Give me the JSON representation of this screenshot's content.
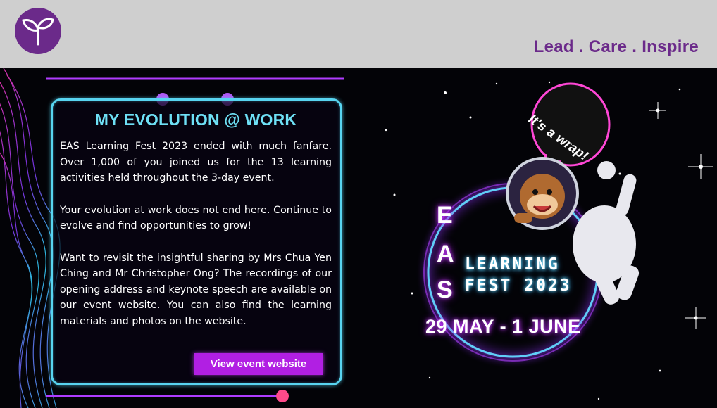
{
  "header": {
    "tagline": "Lead . Care . Inspire",
    "background_color": "#cfcfcf",
    "brand_color": "#6b2a8a",
    "logo_icon": "sprout-icon"
  },
  "card": {
    "title": "MY EVOLUTION @ WORK",
    "paragraphs": [
      "EAS Learning Fest 2023 ended with much fanfare. Over 1,000 of you joined us for the 13 learning activities held throughout the 3-day event.",
      "Your evolution at work does not end here. Continue to evolve and find opportunities to grow!",
      "Want to revisit the insightful sharing by Mrs Chua Yen Ching and Mr Christopher Ong? The recordings of our opening address and keynote speech are available on our event website. You can also find the learning materials and photos on the website."
    ],
    "cta_label": "View event website",
    "border_color": "#58d4f0",
    "cta_color": "#b11fe3"
  },
  "fest": {
    "speech_bubble": "It's a wrap!",
    "eas_letters": [
      "E",
      "A",
      "S"
    ],
    "learning_word": "LEARNING",
    "fest_year": "FEST 2023",
    "dates": "29 MAY - 1 JUNE",
    "mascot_icon": "astronaut-monkey-icon"
  }
}
